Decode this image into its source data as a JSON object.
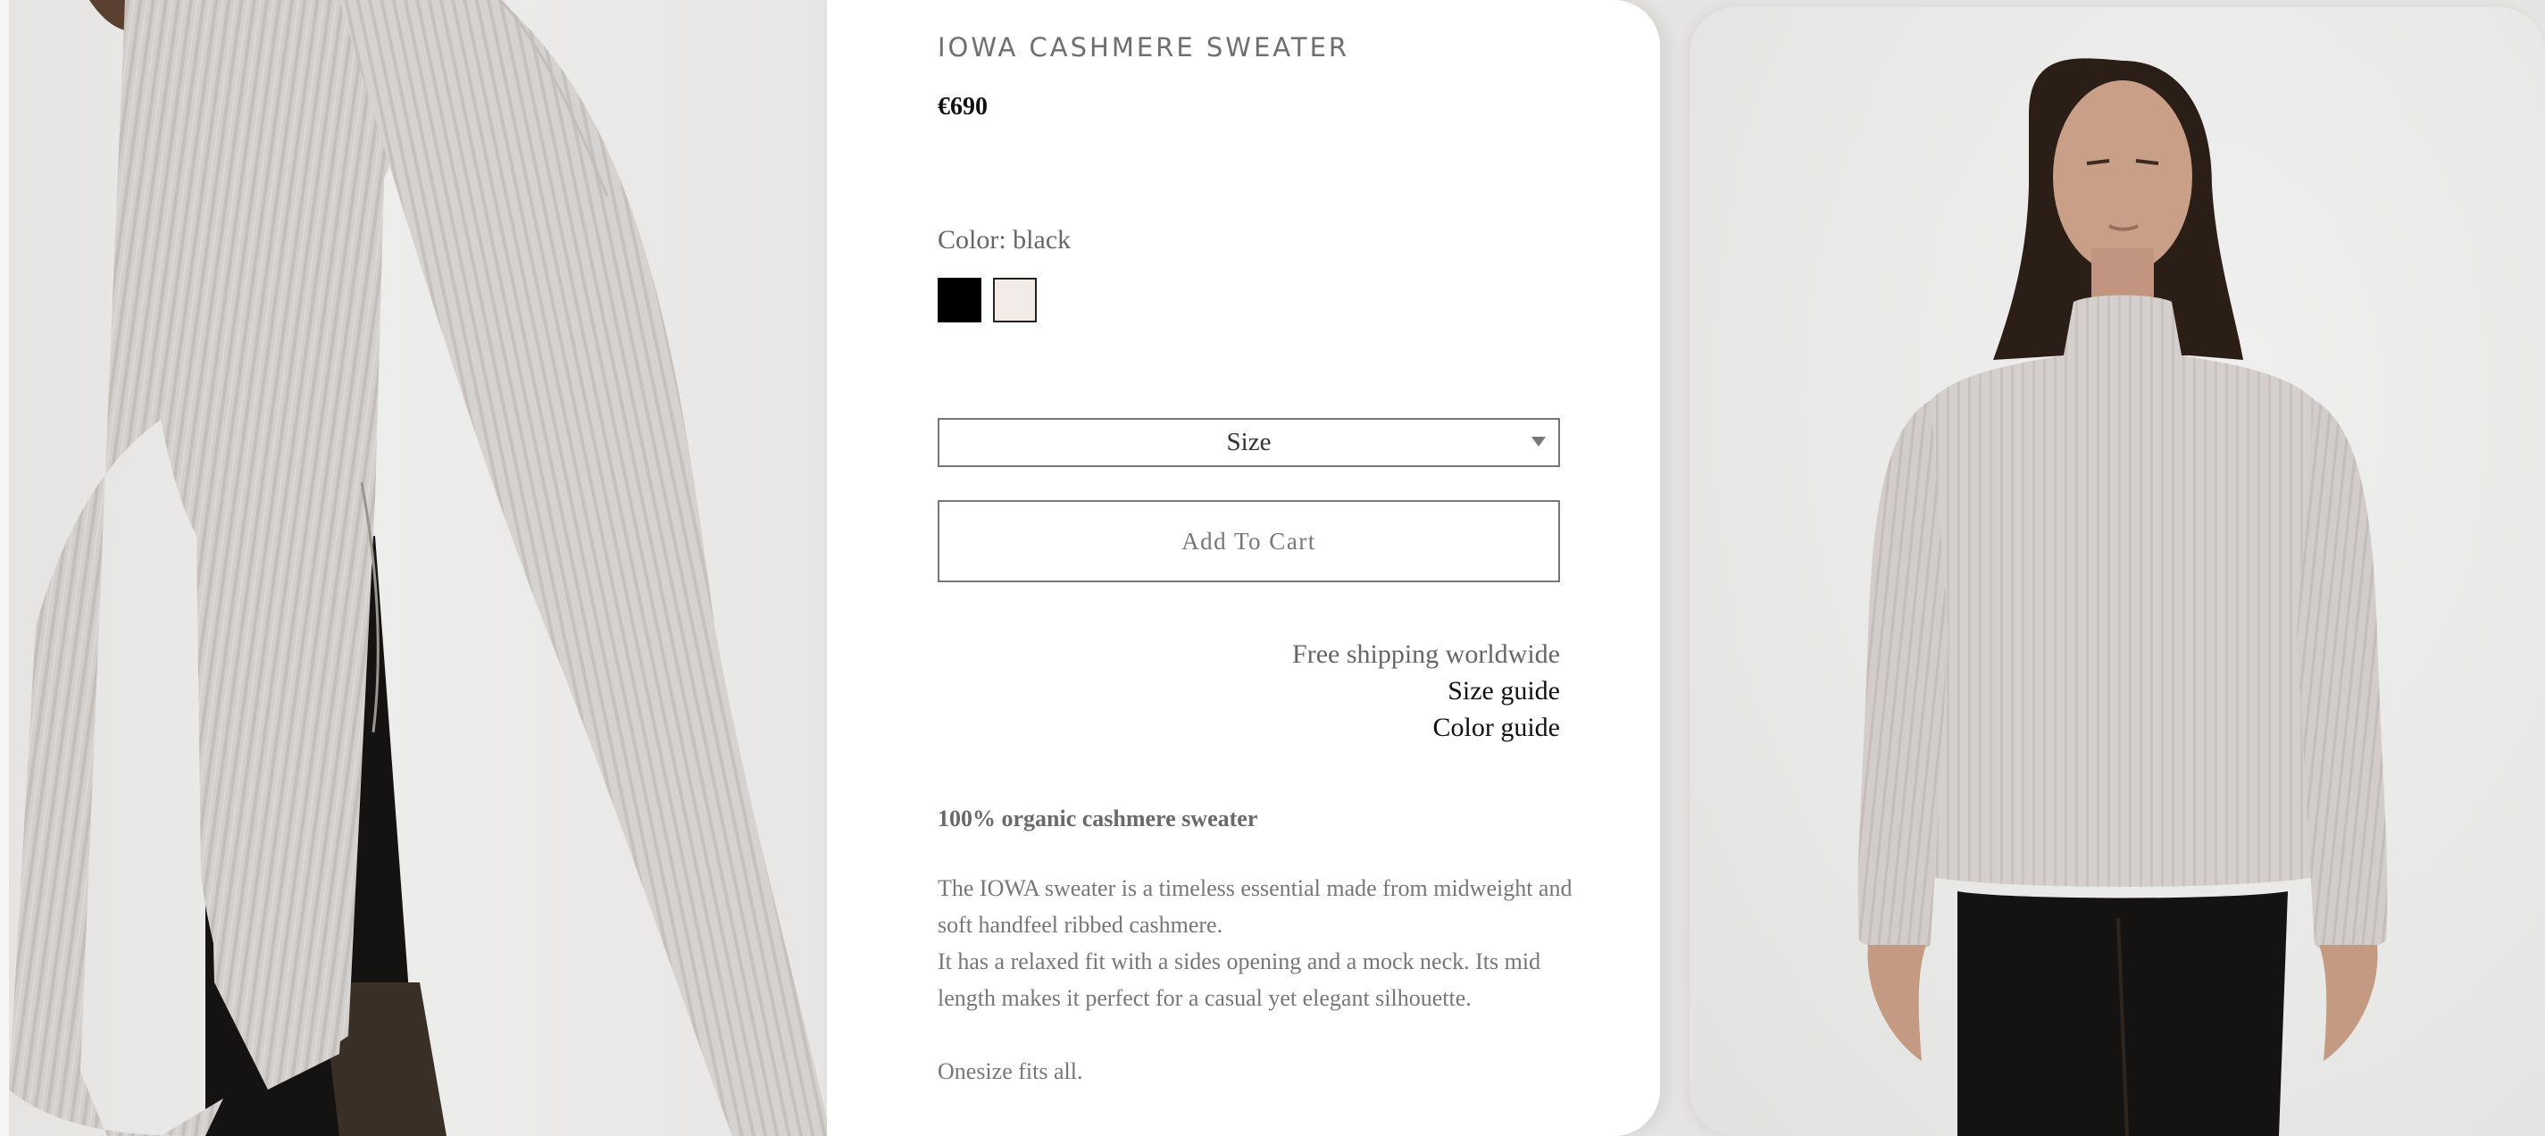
{
  "product": {
    "title": "IOWA CASHMERE SWEATER",
    "price": "€690",
    "color_label": "Color: black",
    "swatches": [
      {
        "name": "black",
        "color": "#000000",
        "selected": true
      },
      {
        "name": "cream",
        "color": "#f1ece8",
        "selected": false
      }
    ],
    "size_placeholder": "Size",
    "add_to_cart_label": "Add To Cart",
    "shipping_note": "Free shipping worldwide",
    "size_guide_link": "Size guide",
    "color_guide_link": "Color guide",
    "description": {
      "headline": "100% organic cashmere sweater",
      "paragraph_1": "The IOWA sweater is a timeless essential made from midweight and soft handfeel ribbed cashmere.",
      "paragraph_2": "It has a relaxed fit with a sides opening and a mock neck. Its mid length makes it perfect for a casual yet elegant silhouette.",
      "fit_note": "Onesize fits all."
    }
  },
  "images": {
    "left": "sweater-side-detail-photo",
    "right": "model-front-photo"
  },
  "colors": {
    "panel_bg": "#ffffff",
    "text_muted": "#777777",
    "sweater": "#d3cecb",
    "trousers": "#151311"
  }
}
